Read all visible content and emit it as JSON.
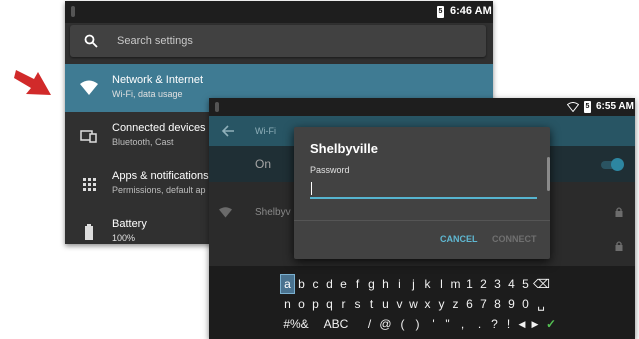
{
  "settings_screen": {
    "status_time": "6:46 AM",
    "battery_label": "5",
    "search_placeholder": "Search settings",
    "items": [
      {
        "title": "Network & Internet",
        "subtitle": "Wi-Fi, data usage",
        "icon": "wifi-icon"
      },
      {
        "title": "Connected devices",
        "subtitle": "Bluetooth, Cast",
        "icon": "devices-icon"
      },
      {
        "title": "Apps & notifications",
        "subtitle": "Permissions, default ap",
        "icon": "apps-grid-icon"
      },
      {
        "title": "Battery",
        "subtitle": "100%",
        "icon": "battery-icon"
      }
    ]
  },
  "wifi_screen": {
    "status_time": "6:55 AM",
    "battery_label": "5",
    "toolbar_title": "Wi-Fi",
    "on_label": "On",
    "network_name": "Shelbyv",
    "dialog": {
      "title": "Shelbyville",
      "password_label": "Password",
      "password_value": "",
      "cancel_label": "CANCEL",
      "connect_label": "CONNECT"
    },
    "keyboard": {
      "row1": [
        "a",
        "b",
        "c",
        "d",
        "e",
        "f",
        "g",
        "h",
        "i",
        "j",
        "k",
        "l",
        "m",
        "1",
        "2",
        "3",
        "4",
        "5",
        "⌫"
      ],
      "row2": [
        "n",
        "o",
        "p",
        "q",
        "r",
        "s",
        "t",
        "u",
        "v",
        "w",
        "x",
        "y",
        "z",
        "6",
        "7",
        "8",
        "9",
        "0",
        "␣"
      ],
      "row3": [
        "#%&",
        "ABC",
        "/",
        "@",
        "(",
        ")",
        "'",
        "\"",
        ",",
        ".",
        "?",
        "!",
        "◀",
        "▶",
        "✓"
      ]
    }
  },
  "colors": {
    "accent_active_row": "#3f7b93",
    "wifi_toolbar": "#285564",
    "cancel_text": "#5fb8d2",
    "arrow_red": "#d12a2a",
    "keyboard_done": "#54c053"
  }
}
